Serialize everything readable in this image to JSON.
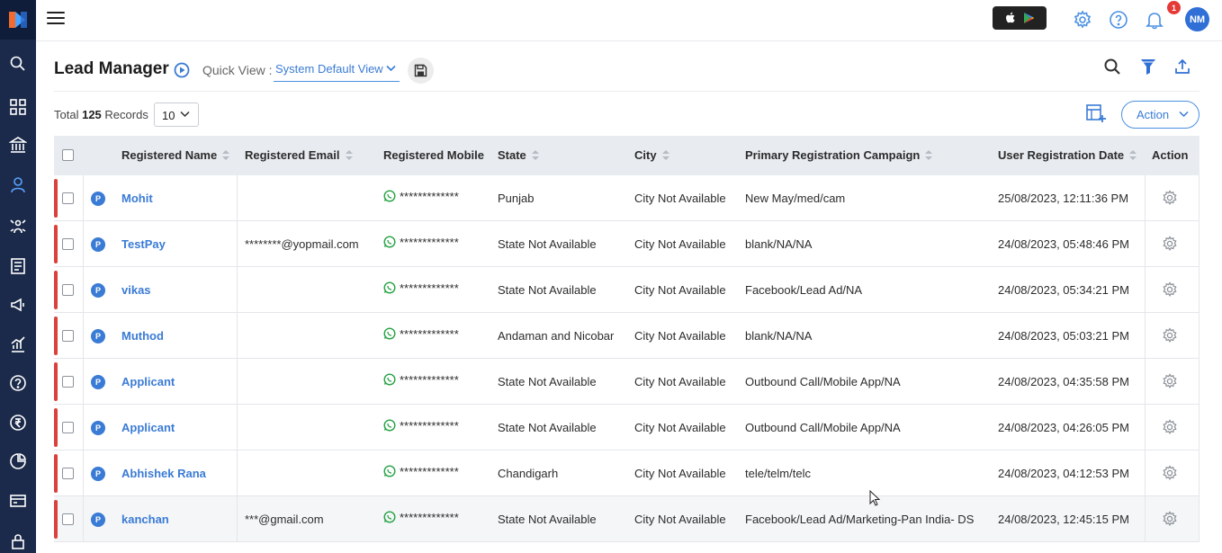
{
  "topbar": {
    "notification_count": "1",
    "user_initials": "NM"
  },
  "header": {
    "title": "Lead Manager",
    "quick_view_label": "Quick View :",
    "quick_view_value": "System Default View"
  },
  "records": {
    "prefix": "Total",
    "count": "125",
    "suffix": "Records",
    "page_size": "10"
  },
  "action_button": "Action",
  "columns": [
    "Registered Name",
    "Registered Email",
    "Registered Mobile",
    "State",
    "City",
    "Primary Registration Campaign",
    "User Registration Date",
    "Action"
  ],
  "rows": [
    {
      "badge": "P",
      "name": "Mohit",
      "email": "",
      "mobile": "*************",
      "state": "Punjab",
      "city": "City Not Available",
      "campaign": "New May/med/cam",
      "date": "25/08/2023, 12:11:36 PM"
    },
    {
      "badge": "P",
      "name": "TestPay",
      "email": "********@yopmail.com",
      "mobile": "*************",
      "state": "State Not Available",
      "city": "City Not Available",
      "campaign": "blank/NA/NA",
      "date": "24/08/2023, 05:48:46 PM"
    },
    {
      "badge": "P",
      "name": "vikas",
      "email": "",
      "mobile": "*************",
      "state": "State Not Available",
      "city": "City Not Available",
      "campaign": "Facebook/Lead Ad/NA",
      "date": "24/08/2023, 05:34:21 PM"
    },
    {
      "badge": "P",
      "name": "Muthod",
      "email": "",
      "mobile": "*************",
      "state": "Andaman and Nicobar",
      "city": "City Not Available",
      "campaign": "blank/NA/NA",
      "date": "24/08/2023, 05:03:21 PM"
    },
    {
      "badge": "P",
      "name": "Applicant",
      "email": "",
      "mobile": "*************",
      "state": "State Not Available",
      "city": "City Not Available",
      "campaign": "Outbound Call/Mobile App/NA",
      "date": "24/08/2023, 04:35:58 PM"
    },
    {
      "badge": "P",
      "name": "Applicant",
      "email": "",
      "mobile": "*************",
      "state": "State Not Available",
      "city": "City Not Available",
      "campaign": "Outbound Call/Mobile App/NA",
      "date": "24/08/2023, 04:26:05 PM"
    },
    {
      "badge": "P",
      "name": "Abhishek Rana",
      "email": "",
      "mobile": "*************",
      "state": "Chandigarh",
      "city": "City Not Available",
      "campaign": "tele/telm/telc",
      "date": "24/08/2023, 04:12:53 PM"
    },
    {
      "badge": "P",
      "name": "kanchan",
      "email": "***@gmail.com",
      "mobile": "*************",
      "state": "State Not Available",
      "city": "City Not Available",
      "campaign": "Facebook/Lead Ad/Marketing-Pan India- DS",
      "date": "24/08/2023, 12:45:15 PM"
    }
  ],
  "sidebar_icons": [
    "search-icon",
    "dashboard-icon",
    "institution-icon",
    "user-icon",
    "network-icon",
    "forms-icon",
    "campaign-icon",
    "analytics-icon",
    "help-icon",
    "rupee-icon",
    "pie-chart-icon",
    "payment-card-icon",
    "lock-icon"
  ],
  "colors": {
    "sidebar": "#1b2a4a",
    "accent": "#3a7bd5",
    "row_marker": "#d9423a",
    "header_bg": "#e8ebef"
  }
}
